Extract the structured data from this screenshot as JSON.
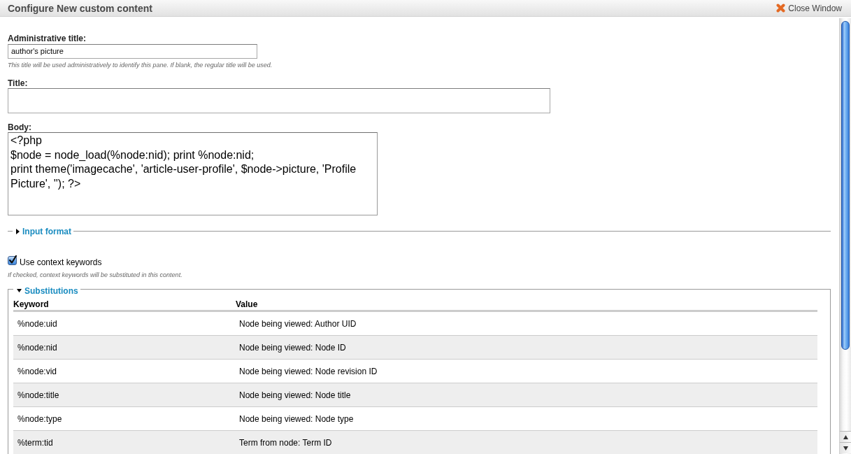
{
  "window": {
    "title": "Configure New custom content",
    "close": "Close Window"
  },
  "fields": [
    {
      "kind": "short",
      "label": "Administrative title:",
      "value": "author's picture",
      "description": "This title will be used administratively to identify this pane. If blank, the regular title will be used."
    },
    {
      "kind": "wide",
      "label": "Title:"
    },
    {
      "kind": "code",
      "label": "Body:",
      "value": "<?php\n$node = node_load(%node:nid); print %node:nid;\nprint theme('imagecache', 'article-user-profile', $node->picture, 'Profile Picture', ''); ?>"
    }
  ],
  "input_format": {
    "label": "Input format",
    "expanded": false
  },
  "context_keywords": {
    "label": "Use context keywords",
    "checked": true,
    "description": "If checked, context keywords will be substituted in this content."
  },
  "substitutions": {
    "label": "Substitutions",
    "expanded": true,
    "columns": [
      "Keyword",
      "Value"
    ],
    "rows": [
      [
        "%node:uid",
        "Node being viewed: Author UID"
      ],
      [
        "%node:nid",
        "Node being viewed: Node ID"
      ],
      [
        "%node:vid",
        "Node being viewed: Node revision ID"
      ],
      [
        "%node:title",
        "Node being viewed: Node title"
      ],
      [
        "%node:type",
        "Node being viewed: Node type"
      ],
      [
        "%term:tid",
        "Term from node: Term ID"
      ]
    ]
  }
}
